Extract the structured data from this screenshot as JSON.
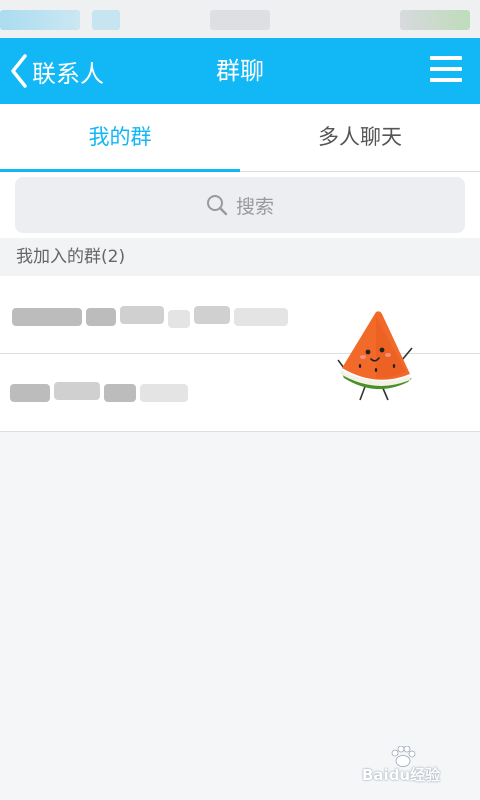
{
  "nav": {
    "back_label": "联系人",
    "title": "群聊"
  },
  "tabs": [
    {
      "label": "我的群",
      "active": true
    },
    {
      "label": "多人聊天",
      "active": false
    }
  ],
  "search": {
    "placeholder": "搜索"
  },
  "section": {
    "header": "我加入的群(2)"
  },
  "groups": [
    {
      "name_blurred": true
    },
    {
      "name_blurred": true
    }
  ],
  "watermark": {
    "text": "Baidu经验"
  },
  "colors": {
    "accent": "#12b7f5",
    "tab_active": "#12b7f5",
    "background": "#f5f6f8"
  }
}
